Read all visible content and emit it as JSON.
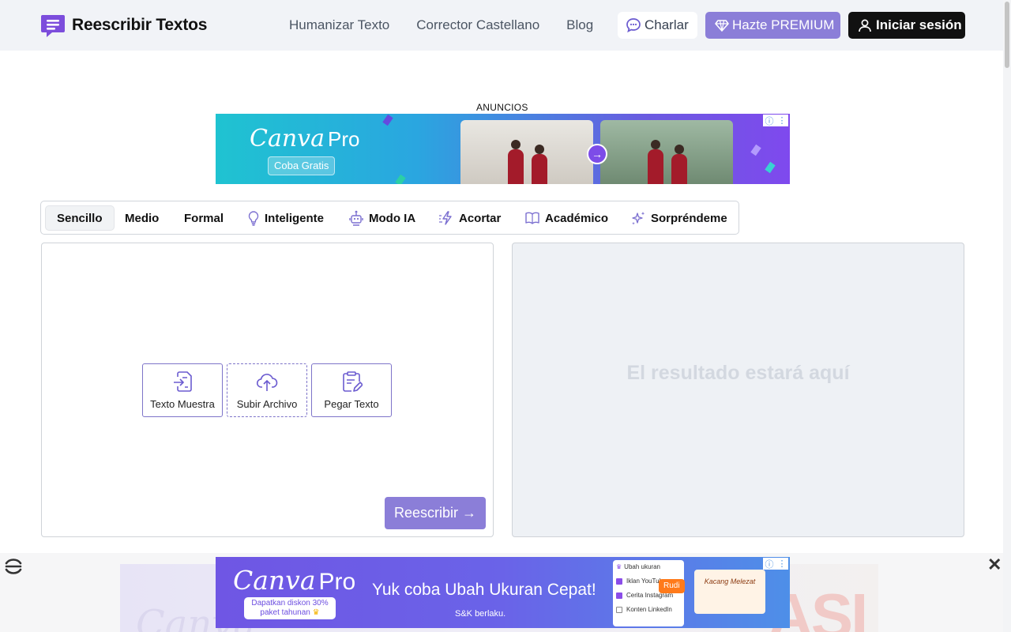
{
  "header": {
    "brand": "Reescribir Textos",
    "nav": [
      "Humanizar Texto",
      "Corrector Castellano",
      "Blog"
    ],
    "chat_label": "Charlar",
    "premium_label": "Hazte PREMIUM",
    "login_label": "Iniciar sesión",
    "accent": "#8b7ed8"
  },
  "ad_top": {
    "label": "ANUNCIOS",
    "brand": "Canva",
    "brand_suffix": "Pro",
    "cta": "Coba Gratis"
  },
  "tabs": [
    {
      "label": "Sencillo",
      "icon": "none",
      "active": true
    },
    {
      "label": "Medio",
      "icon": "none"
    },
    {
      "label": "Formal",
      "icon": "none"
    },
    {
      "label": "Inteligente",
      "icon": "lightbulb-icon"
    },
    {
      "label": "Modo IA",
      "icon": "robot-icon"
    },
    {
      "label": "Acortar",
      "icon": "lightning-icon"
    },
    {
      "label": "Académico",
      "icon": "book-icon"
    },
    {
      "label": "Sorpréndeme",
      "icon": "sparkles-icon"
    }
  ],
  "editor": {
    "actions": [
      "Texto Muestra",
      "Subir Archivo",
      "Pegar Texto"
    ],
    "rewrite_label": "Reescribir →",
    "result_placeholder": "El resultado estará aquí"
  },
  "ad_bottom": {
    "brand": "Canva",
    "brand_suffix": "Pro",
    "promo_line1": "Dapatkan diskon 30%",
    "promo_line2": "paket tahunan",
    "headline": "Yuk coba Ubah Ukuran Cepat!",
    "subtext": "S&K berlaku.",
    "card_title": "Ubah ukuran",
    "card_items": [
      "Iklan YouTube",
      "Cerita Instagram",
      "Konten LinkedIn"
    ],
    "cursor_name": "Rudi",
    "card2_text": "Kacang Melezat"
  }
}
